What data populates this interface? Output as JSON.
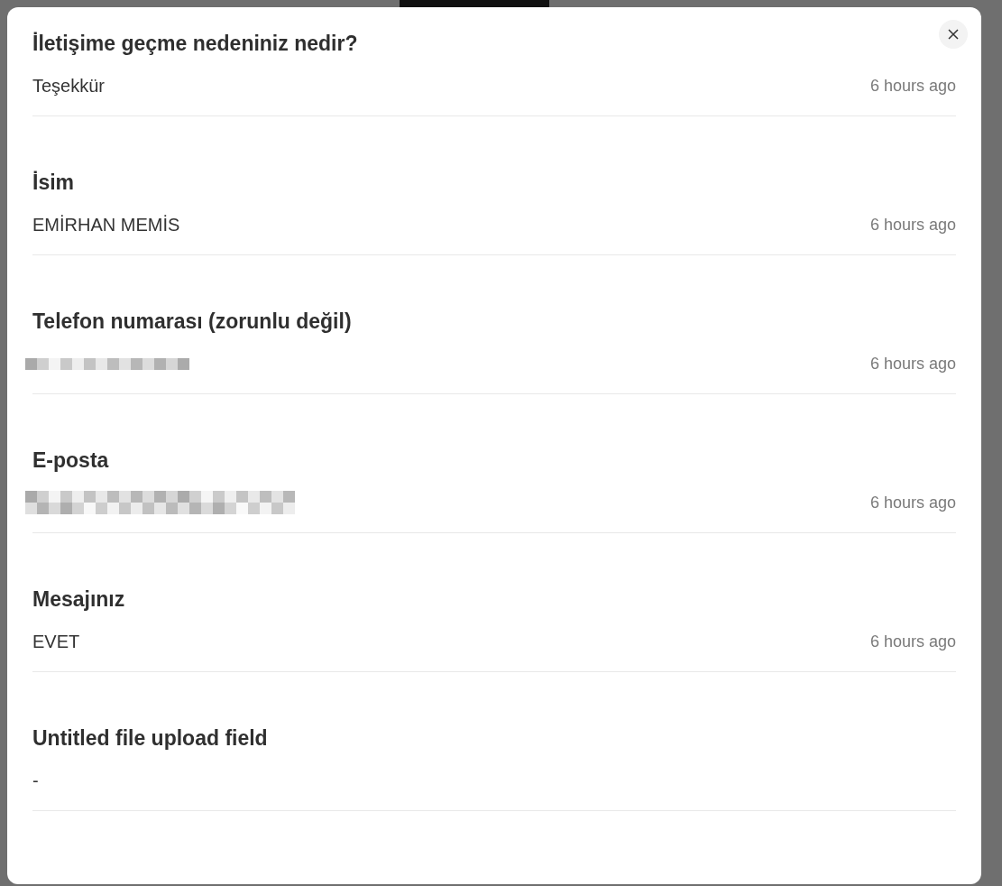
{
  "submission": {
    "fields": [
      {
        "label": "İletişime geçme nedeniniz nedir?",
        "kind": "text",
        "value": "Teşekkür",
        "time": "6 hours ago"
      },
      {
        "label": "İsim",
        "kind": "text",
        "value": "EMİRHAN MEMİS",
        "time": "6 hours ago"
      },
      {
        "label": "Telefon numarası (zorunlu değil)",
        "kind": "redacted",
        "time": "6 hours ago"
      },
      {
        "label": "E-posta",
        "kind": "redacted",
        "time": "6 hours ago"
      },
      {
        "label": "Mesajınız",
        "kind": "text",
        "value": "EVET",
        "time": "6 hours ago"
      },
      {
        "label": "Untitled file upload field",
        "kind": "text",
        "value": "-"
      }
    ]
  }
}
